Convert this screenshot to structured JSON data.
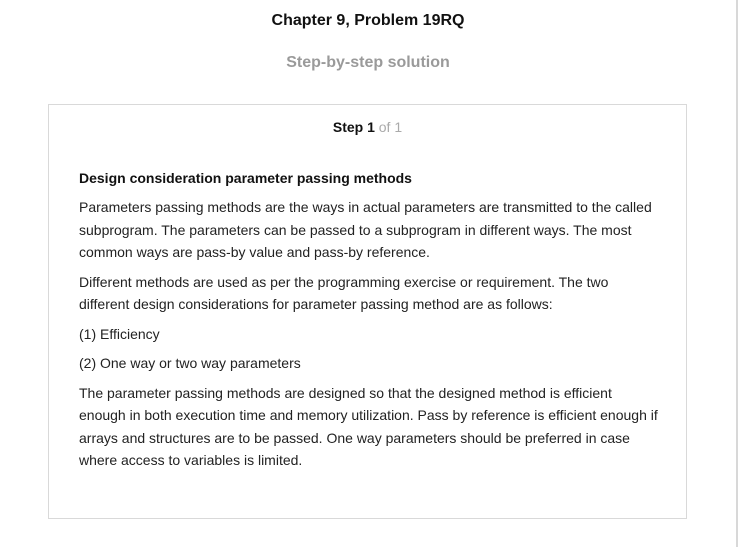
{
  "header": {
    "title": "Chapter 9, Problem 19RQ",
    "subtitle": "Step-by-step solution"
  },
  "step": {
    "label": "Step 1",
    "of": "of 1",
    "heading": "Design consideration parameter passing methods",
    "paragraphs": [
      "Parameters passing methods are the ways in actual parameters are transmitted to the called subprogram. The parameters can be passed to a subprogram in different ways. The most common ways are pass-by value and pass-by reference.",
      "Different methods are used as per the programming exercise or requirement. The two different design considerations for parameter passing method are as follows:",
      "(1) Efficiency",
      "(2) One way or two way parameters",
      "The parameter passing methods are designed so that the designed method is efficient enough in both execution time and memory utilization. Pass by reference is efficient enough if arrays and structures are to be passed. One way parameters should be preferred in case where access to variables is limited."
    ]
  }
}
